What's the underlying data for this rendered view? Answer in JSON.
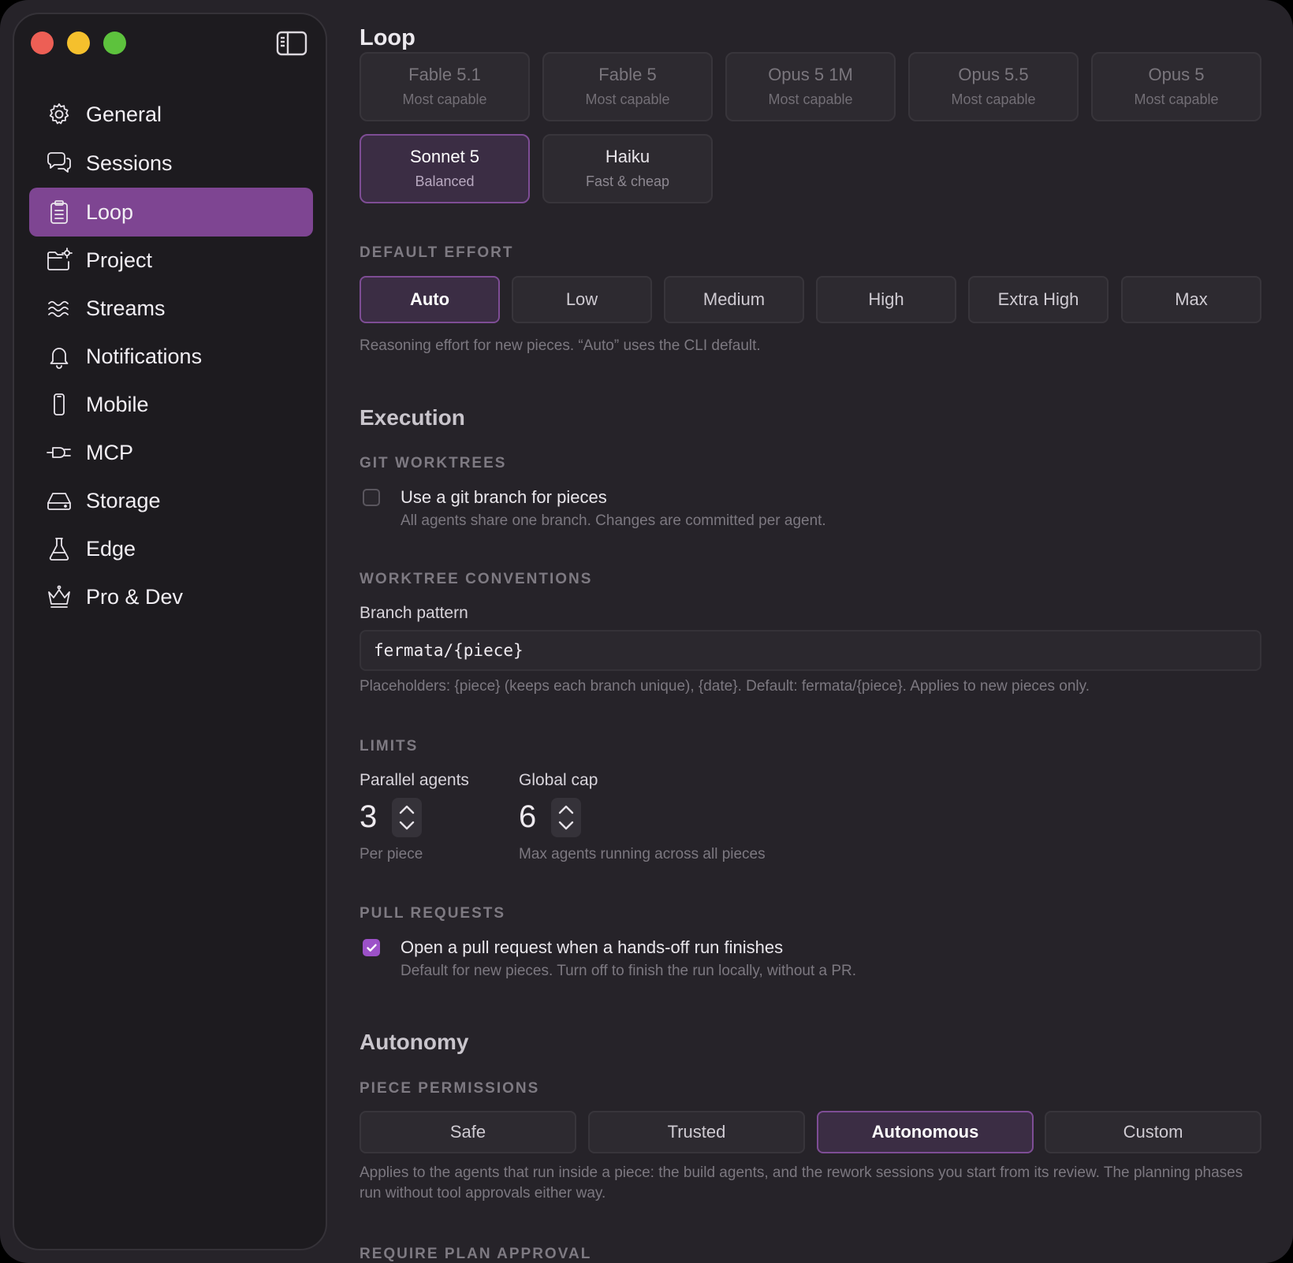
{
  "sidebar": {
    "items": [
      {
        "label": "General",
        "icon": "gear-icon"
      },
      {
        "label": "Sessions",
        "icon": "chat-bubbles-icon"
      },
      {
        "label": "Loop",
        "icon": "clipboard-icon",
        "active": true
      },
      {
        "label": "Project",
        "icon": "folder-gear-icon"
      },
      {
        "label": "Streams",
        "icon": "waves-icon"
      },
      {
        "label": "Notifications",
        "icon": "bell-icon"
      },
      {
        "label": "Mobile",
        "icon": "phone-icon"
      },
      {
        "label": "MCP",
        "icon": "plug-icon"
      },
      {
        "label": "Storage",
        "icon": "drive-icon"
      },
      {
        "label": "Edge",
        "icon": "flask-icon"
      },
      {
        "label": "Pro & Dev",
        "icon": "crown-icon"
      }
    ]
  },
  "page": {
    "title": "Loop"
  },
  "models": [
    {
      "name": "Fable 5.1",
      "desc": "Most capable"
    },
    {
      "name": "Fable 5",
      "desc": "Most capable"
    },
    {
      "name": "Opus 5 1M",
      "desc": "Most capable"
    },
    {
      "name": "Opus 5.5",
      "desc": "Most capable"
    },
    {
      "name": "Opus 5",
      "desc": "Most capable"
    },
    {
      "name": "Sonnet 5",
      "desc": "Balanced",
      "selected": true
    },
    {
      "name": "Haiku",
      "desc": "Fast & cheap"
    }
  ],
  "effort": {
    "label": "DEFAULT EFFORT",
    "options": [
      "Auto",
      "Low",
      "Medium",
      "High",
      "Extra High",
      "Max"
    ],
    "selected": "Auto",
    "help": "Reasoning effort for new pieces. “Auto” uses the CLI default."
  },
  "execution": {
    "heading": "Execution",
    "git_worktrees": {
      "label": "GIT WORKTREES",
      "checkbox_label": "Use a git branch for pieces",
      "checkbox_desc": "All agents share one branch. Changes are committed per agent.",
      "checked": false
    },
    "conventions": {
      "label": "WORKTREE CONVENTIONS",
      "field_label": "Branch pattern",
      "value": "fermata/{piece}",
      "help": "Placeholders: {piece} (keeps each branch unique), {date}. Default: fermata/{piece}. Applies to new pieces only."
    },
    "limits": {
      "label": "LIMITS",
      "parallel": {
        "label": "Parallel agents",
        "value": "3",
        "desc": "Per piece"
      },
      "global": {
        "label": "Global cap",
        "value": "6",
        "desc": "Max agents running across all pieces"
      }
    },
    "pull_requests": {
      "label": "PULL REQUESTS",
      "checkbox_label": "Open a pull request when a hands-off run finishes",
      "checkbox_desc": "Default for new pieces. Turn off to finish the run locally, without a PR.",
      "checked": true
    }
  },
  "autonomy": {
    "heading": "Autonomy",
    "permissions": {
      "label": "PIECE PERMISSIONS",
      "options": [
        "Safe",
        "Trusted",
        "Autonomous",
        "Custom"
      ],
      "selected": "Autonomous",
      "help": "Applies to the agents that run inside a piece: the build agents, and the rework sessions you start from its review. The planning phases run without tool approvals either way."
    },
    "plan_approval_label": "REQUIRE PLAN APPROVAL"
  },
  "colors": {
    "accent": "#7e4592",
    "selected_border": "#7e4d95",
    "checkbox": "#9c51c8"
  }
}
